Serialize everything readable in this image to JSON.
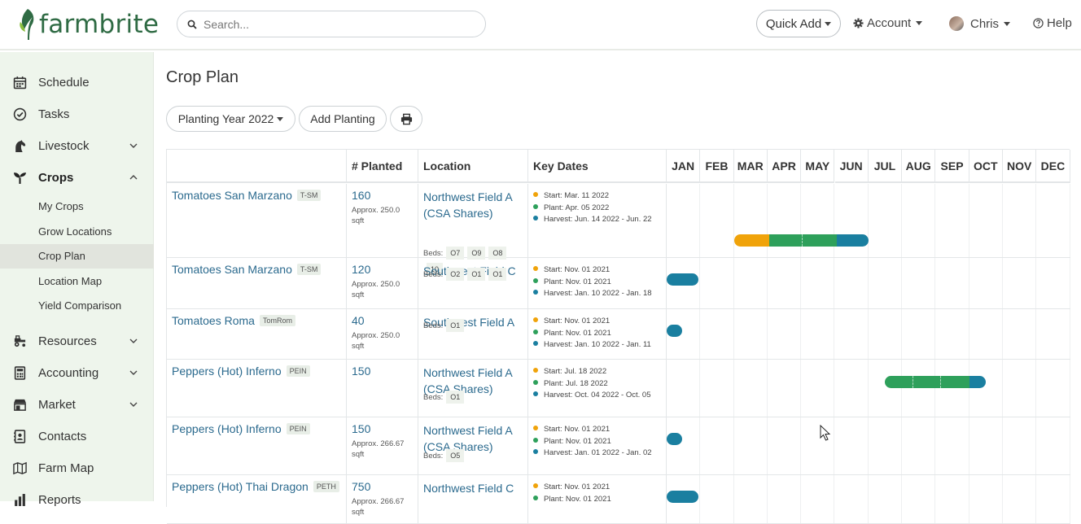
{
  "app": {
    "brand": "farmbrite"
  },
  "header": {
    "search_placeholder": "Search...",
    "quick_add": "Quick Add",
    "account": "Account",
    "user": "Chris",
    "help": "Help"
  },
  "sidebar": {
    "items": [
      {
        "label": "Schedule",
        "icon": "calendar-icon"
      },
      {
        "label": "Tasks",
        "icon": "check-circle-icon"
      },
      {
        "label": "Livestock",
        "icon": "horse-icon"
      },
      {
        "label": "Crops",
        "icon": "seedling-icon"
      },
      {
        "label": "Resources",
        "icon": "tractor-icon"
      },
      {
        "label": "Accounting",
        "icon": "calculator-icon"
      },
      {
        "label": "Market",
        "icon": "store-icon"
      },
      {
        "label": "Contacts",
        "icon": "address-book-icon"
      },
      {
        "label": "Farm Map",
        "icon": "map-icon"
      },
      {
        "label": "Reports",
        "icon": "chart-icon"
      }
    ],
    "crops_sub": [
      "My Crops",
      "Grow Locations",
      "Crop Plan",
      "Location Map",
      "Yield Comparison"
    ]
  },
  "page": {
    "title": "Crop Plan",
    "year_button": "Planting Year 2022",
    "add_button": "Add Planting"
  },
  "table": {
    "headers": {
      "planted": "# Planted",
      "location": "Location",
      "key_dates": "Key Dates"
    },
    "months": [
      "JAN",
      "FEB",
      "MAR",
      "APR",
      "MAY",
      "JUN",
      "JUL",
      "AUG",
      "SEP",
      "OCT",
      "NOV",
      "DEC"
    ],
    "beds_label": "Beds:",
    "rows": [
      {
        "crop": "Tomatoes San Marzano",
        "tag": "T-SM",
        "planted": "160",
        "approx": "Approx. 250.0 sqft",
        "loc1": "Northwest Field A",
        "loc2": "(CSA Shares)",
        "beds": [
          "O7",
          "O9",
          "O8",
          "10"
        ],
        "start": "Start: Mar. 11 2022",
        "plant": "Plant: Apr. 05 2022",
        "harvest": "Harvest: Jun. 14 2022 - Jun. 22"
      },
      {
        "crop": "Tomatoes San Marzano",
        "tag": "T-SM",
        "planted": "120",
        "approx": "Approx. 250.0 sqft",
        "loc1": "Southwest Field C",
        "loc2": "",
        "beds": [
          "O2",
          "O1",
          "O1"
        ],
        "start": "Start: Nov. 01 2021",
        "plant": "Plant: Nov. 01 2021",
        "harvest": "Harvest: Jan. 10 2022 - Jan. 18"
      },
      {
        "crop": "Tomatoes Roma",
        "tag": "TomRom",
        "planted": "40",
        "approx": "Approx. 250.0 sqft",
        "loc1": "Southwest Field A",
        "loc2": "",
        "beds": [
          "O1"
        ],
        "start": "Start: Nov. 01 2021",
        "plant": "Plant: Nov. 01 2021",
        "harvest": "Harvest: Jan. 10 2022 - Jan. 11"
      },
      {
        "crop": "Peppers (Hot) Inferno",
        "tag": "PEIN",
        "planted": "150",
        "approx": "",
        "loc1": "Northwest Field A",
        "loc2": "(CSA Shares)",
        "beds": [
          "O1"
        ],
        "start": "Start: Jul. 18 2022",
        "plant": "Plant: Jul. 18 2022",
        "harvest": "Harvest: Oct. 04 2022 - Oct. 05"
      },
      {
        "crop": "Peppers (Hot) Inferno",
        "tag": "PEIN",
        "planted": "150",
        "approx": "Approx. 266.67 sqft",
        "loc1": "Northwest Field A",
        "loc2": "(CSA Shares)",
        "beds": [
          "O5"
        ],
        "start": "Start: Nov. 01 2021",
        "plant": "Plant: Nov. 01 2021",
        "harvest": "Harvest: Jan. 01 2022 - Jan. 02"
      },
      {
        "crop": "Peppers (Hot) Thai Dragon",
        "tag": "PETH",
        "planted": "750",
        "approx": "Approx. 266.67 sqft",
        "loc1": "Northwest Field C",
        "loc2": "",
        "beds": [],
        "start": "Start: Nov. 01 2021",
        "plant": "Plant: Nov. 01 2021",
        "harvest": ""
      }
    ]
  },
  "colors": {
    "start": "#f0a30a",
    "plant": "#2ea05b",
    "harvest": "#1a7fa0",
    "link": "#2b6a8e",
    "brand": "#2f6b44"
  }
}
